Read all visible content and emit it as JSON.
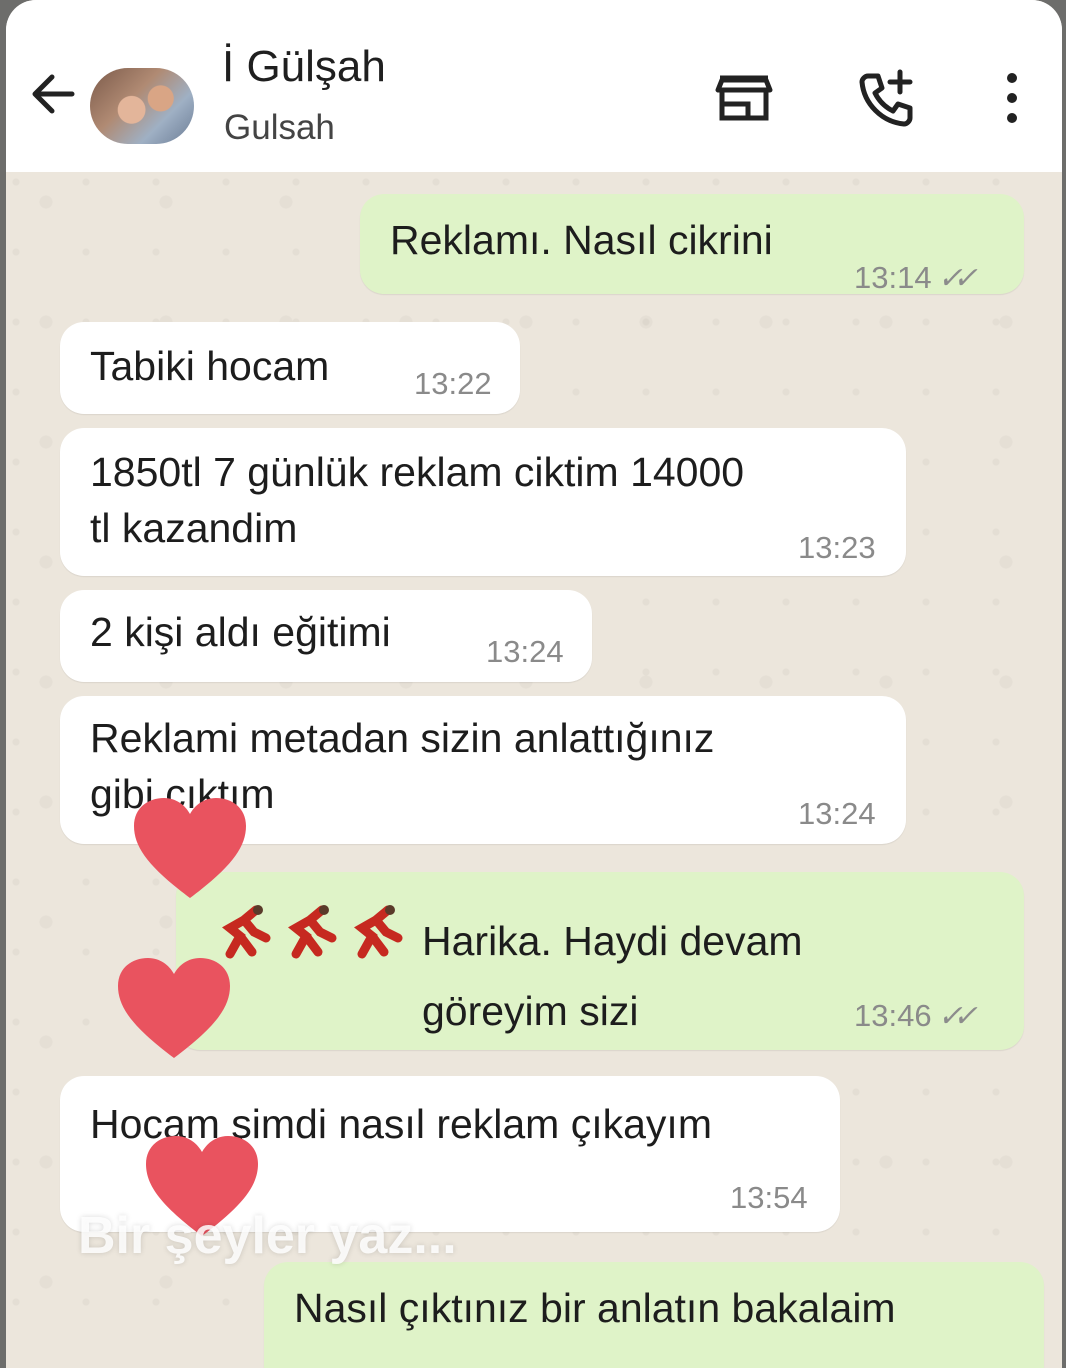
{
  "header": {
    "contact_name": "İ Gülşah",
    "contact_subtitle": "Gulsah",
    "icons": [
      "back-arrow-icon",
      "store-icon",
      "add-call-icon",
      "more-vert-icon"
    ]
  },
  "messages": [
    {
      "direction": "outgoing",
      "text": "Reklamı. Nasıl cikrini",
      "time": "13:14",
      "read": true
    },
    {
      "direction": "incoming",
      "text": "Tabiki hocam",
      "time": "13:22"
    },
    {
      "direction": "incoming",
      "text": "1850tl 7 günlük reklam ciktim 14000\ntl kazandim",
      "time": "13:23"
    },
    {
      "direction": "incoming",
      "text": "2 kişi aldı eğitimi",
      "time": "13:24"
    },
    {
      "direction": "incoming",
      "text": "Reklami metadan sizin anlattığınız\ngibi çıktım",
      "time": "13:24"
    },
    {
      "direction": "outgoing",
      "text": "Harika. Haydi devam\ngöreyim sizi",
      "time": "13:46",
      "read": true,
      "emoji": "dancing-woman-emoji x3"
    },
    {
      "direction": "incoming",
      "text": "Hocam şimdi nasıl reklam çıkayım",
      "time": "13:54"
    },
    {
      "direction": "outgoing",
      "text": "Nasıl çıktınız bir anlatın bakalaim",
      "time": ""
    }
  ],
  "compose": {
    "placeholder": "Bir şeyler yaz..."
  },
  "colors": {
    "incoming": "#ffffff",
    "outgoing": "#dff3c8",
    "heart": "#e9535f",
    "chat_bg": "#ece6dc"
  }
}
